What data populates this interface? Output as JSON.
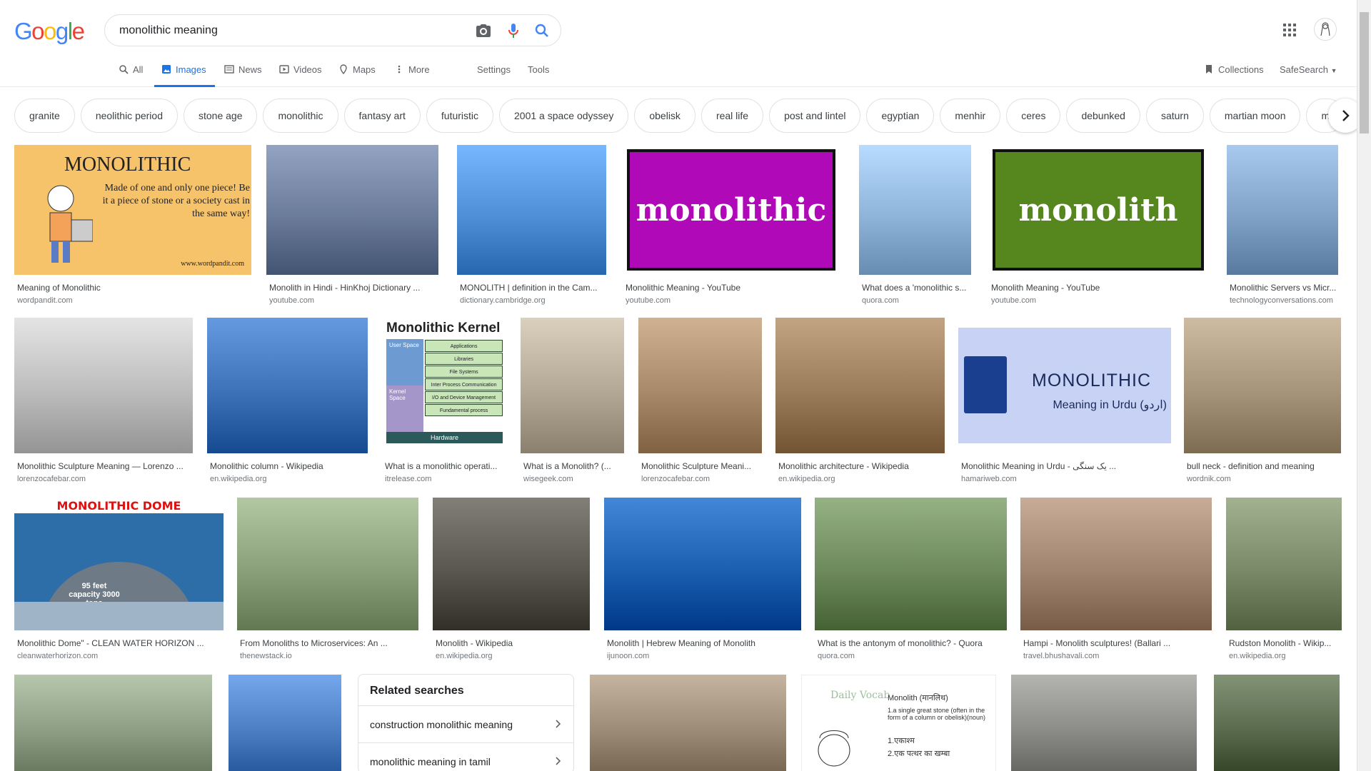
{
  "logo": {
    "letters": [
      "G",
      "o",
      "o",
      "g",
      "l",
      "e"
    ],
    "colors": [
      "#4285F4",
      "#EA4335",
      "#FBBC05",
      "#4285F4",
      "#34A853",
      "#EA4335"
    ]
  },
  "search": {
    "value": "monolithic meaning"
  },
  "tabs": {
    "all": "All",
    "images": "Images",
    "news": "News",
    "videos": "Videos",
    "maps": "Maps",
    "more": "More",
    "settings": "Settings",
    "tools": "Tools",
    "collections": "Collections",
    "safesearch": "SafeSearch"
  },
  "chips": [
    "granite",
    "neolithic period",
    "stone age",
    "monolithic",
    "fantasy art",
    "futuristic",
    "2001 a space odyssey",
    "obelisk",
    "real life",
    "post and lintel",
    "egyptian",
    "menhir",
    "ceres",
    "debunked",
    "saturn",
    "martian moon",
    "m"
  ],
  "images": [
    {
      "caption": "Meaning of Monolithic",
      "source": "wordpandit.com",
      "thumb_text": "MONOLITHIC",
      "thumb_sub": "Made of one and only one piece! Be it a piece of stone or a society cast in the same way!",
      "thumb_url": "www.wordpandit.com",
      "color": "#f6c36a"
    },
    {
      "caption": "Monolith in Hindi - HinKhoj Dictionary ...",
      "source": "youtube.com",
      "color": "#6b7b9a"
    },
    {
      "caption": "MONOLITH | definition in the Cam...",
      "source": "dictionary.cambridge.org",
      "color": "#4e8fd8"
    },
    {
      "caption": "Monolithic Meaning - YouTube",
      "source": "youtube.com",
      "thumb_text": "monolithic",
      "color": "#b00ab8"
    },
    {
      "caption": "What does a 'monolithic s...",
      "source": "quora.com",
      "color": "#8fb4da"
    },
    {
      "caption": "Monolith Meaning - YouTube",
      "source": "youtube.com",
      "thumb_text": "monolith",
      "color": "#56861e"
    },
    {
      "caption": "Monolithic Servers vs Micr...",
      "source": "technologyconversations.com",
      "color": "#7fa2c6"
    },
    {
      "caption": "Monolithic Sculpture Meaning — Lorenzo ...",
      "source": "lorenzocafebar.com",
      "color": "#bcbcbc"
    },
    {
      "caption": "Monolithic column - Wikipedia",
      "source": "en.wikipedia.org",
      "color": "#3d72b8"
    },
    {
      "caption": "What is a monolithic operati...",
      "source": "itrelease.com",
      "thumb_text": "Monolithic Kernel",
      "color": "#ffffff"
    },
    {
      "caption": "What is a Monolith? (...",
      "source": "wisegeek.com",
      "color": "#b3a795"
    },
    {
      "caption": "Monolithic Sculpture Meani...",
      "source": "lorenzocafebar.com",
      "color": "#a8896a"
    },
    {
      "caption": "Monolithic architecture - Wikipedia",
      "source": "en.wikipedia.org",
      "color": "#9a7b5a"
    },
    {
      "caption": "Monolithic Meaning in Urdu - یک سنگی ...",
      "source": "hamariweb.com",
      "thumb_text": "MONOLITHIC",
      "thumb_sub": "Meaning in Urdu (اردو)",
      "color": "#c7d2f4"
    },
    {
      "caption": "bull neck - definition and meaning",
      "source": "wordnik.com",
      "color": "#a5947a"
    },
    {
      "caption": "Monolithic Dome\" - CLEAN WATER HORIZON ...",
      "source": "cleanwaterhorizon.com",
      "thumb_text": "MONOLITHIC DOME",
      "thumb_sub": "95 feet capacity 3000 tons",
      "color": "#2e6ea8"
    },
    {
      "caption": "From Monoliths to Microservices: An ...",
      "source": "thenewstack.io",
      "color": "#8aa07a"
    },
    {
      "caption": "Monolith - Wikipedia",
      "source": "en.wikipedia.org",
      "color": "#5a5650"
    },
    {
      "caption": "Monolith | Hebrew Meaning of Monolith",
      "source": "ijunoon.com",
      "color": "#1a5fb0"
    },
    {
      "caption": "What is the antonym of monolithic? - Quora",
      "source": "quora.com",
      "color": "#6d8a5c"
    },
    {
      "caption": "Hampi - Monolith sculptures! (Ballari ...",
      "source": "travel.bhushavali.com",
      "color": "#a08470"
    },
    {
      "caption": "Rudston Monolith - Wikip...",
      "source": "en.wikipedia.org",
      "color": "#7a8a68"
    },
    {
      "caption": "",
      "source": "",
      "color": "#8e9f86"
    },
    {
      "caption": "",
      "source": "",
      "color": "#4d7fc4"
    },
    {
      "caption": "",
      "source": "",
      "color": "#9c8c78"
    },
    {
      "caption": "",
      "source": "",
      "thumb_text": "Monolith (मानलिथ)",
      "thumb_sub": "1.a single great stone (often in the form of a column or obelisk)(noun)",
      "thumb_list": [
        "1.एकाश्म",
        "2.एक पत्थर का खम्बा"
      ],
      "thumb_brand": "Daily Vocab",
      "color": "#ffffff"
    },
    {
      "caption": "",
      "source": "",
      "color": "#8c8c88"
    },
    {
      "caption": "",
      "source": "",
      "color": "#5b6b4e"
    }
  ],
  "kernel": {
    "rows": [
      "Applications",
      "Libraries",
      "File Systems",
      "Inter Process Communication",
      "I/O and Device Management",
      "Fundamental process management"
    ],
    "user": "User Space",
    "kernel": "Kernel Space",
    "hw": "Hardware"
  },
  "related": {
    "title": "Related searches",
    "items": [
      "construction monolithic meaning",
      "monolithic meaning in tamil"
    ]
  }
}
